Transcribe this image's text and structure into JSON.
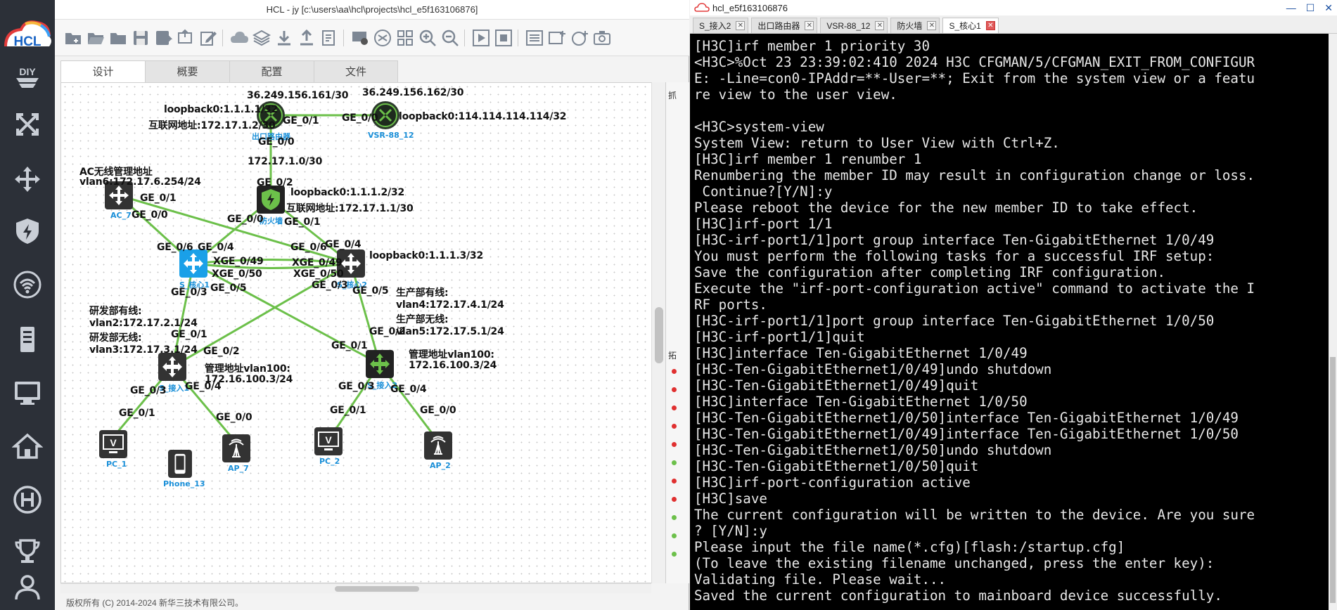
{
  "sidebar": {
    "logo_text": "HCL",
    "items": [
      {
        "name": "diy",
        "icon": "diy-icon"
      },
      {
        "name": "topology-tools",
        "icon": "arrows-cross-icon"
      },
      {
        "name": "move",
        "icon": "move-icon"
      },
      {
        "name": "security",
        "icon": "shield-icon"
      },
      {
        "name": "wireless",
        "icon": "wifi-icon"
      },
      {
        "name": "server",
        "icon": "server-icon"
      },
      {
        "name": "terminal",
        "icon": "monitor-icon"
      },
      {
        "name": "home",
        "icon": "home-icon"
      },
      {
        "name": "h3c",
        "icon": "h3c-logo-icon"
      },
      {
        "name": "achievement",
        "icon": "trophy-icon"
      },
      {
        "name": "user",
        "icon": "user-icon"
      }
    ]
  },
  "hcl": {
    "title": "HCL - jy [c:\\users\\aa\\hcl\\projects\\hcl_e5f163106876]",
    "tabs": [
      "设计",
      "概要",
      "配置",
      "文件"
    ],
    "active_tab": "设计",
    "footer": "版权所有 (C) 2014-2024 新华三技术有限公司。",
    "right_panel": {
      "header1": "抓",
      "header2": "拓"
    },
    "topology": {
      "devices": {
        "exit_router": "出口路由器",
        "vsr": "VSR-88_12",
        "firewall": "防火墙",
        "ac": "AC_7",
        "core1": "S_核心1",
        "core2": "S_核心2",
        "access1": "S_接入1",
        "access2": "S_接入2",
        "pc1": "PC_1",
        "pc2": "PC_2",
        "ap7": "AP_7",
        "ap2": "AP_2",
        "phone": "Phone_13"
      },
      "labels": {
        "l1": "36.249.156.161/30",
        "l2": "36.249.156.162/30",
        "l3": "loopback0:1.1.1.1/32",
        "l4": "互联网地址:172.17.1.2/30",
        "l5": "GE_0/1",
        "l6": "GE_0/0",
        "l7": "loopback0:114.114.114.114/32",
        "l8": "GE_0/0",
        "l9": "172.17.1.0/30",
        "l10": "AC无线管理地址",
        "l11": "vlan6:172.17.6.254/24",
        "l12": "GE_0/2",
        "l13": "loopback0:1.1.1.2/32",
        "l14": "互联网地址:172.17.1.1/30",
        "l15": "GE_0/1",
        "l16": "GE_0/0",
        "l17": "GE_0/0",
        "l18": "GE_0/1",
        "l19": "GE_0/6",
        "l20": "GE_0/4",
        "l21": "GE_0/6",
        "l22": "GE_0/4",
        "l23": "loopback0:1.1.1.3/32",
        "l24": "XGE_0/49",
        "l25": "XGE_0/49",
        "l26": "XGE_0/50",
        "l27": "XGE_0/50",
        "l28": "GE_0/3",
        "l29": "GE_0/5",
        "l30": "GE_0/3",
        "l31": "GE_0/5",
        "l32": "研发部有线:",
        "l33": "vlan2:172.17.2.1/24",
        "l34": "研发部无线:",
        "l35": "vlan3:172.17.3.1/24",
        "l36": "生产部有线:",
        "l37": "vlan4:172.17.4.1/24",
        "l38": "生产部无线:",
        "l39": "vlan5:172.17.5.1/24",
        "l40": "GE_0/1",
        "l41": "GE_0/2",
        "l42": "GE_0/2",
        "l43": "GE_0/1",
        "l44": "管理地址vlan100:",
        "l45": "172.16.100.3/24",
        "l46": "管理地址vlan100:",
        "l47": "172.16.100.3/24",
        "l48": "GE_0/3",
        "l49": "GE_0/4",
        "l50": "GE_0/3",
        "l51": "GE_0/4",
        "l52": "GE_0/1",
        "l53": "GE_0/0",
        "l54": "GE_0/1",
        "l55": "GE_0/0"
      },
      "link_color": "#6cc04a"
    }
  },
  "terminal": {
    "title": "hcl_e5f163106876",
    "tabs": [
      "S_接入2",
      "出口路由器",
      "VSR-88_12",
      "防火墙",
      "S_核心1"
    ],
    "active_tab": "S_核心1",
    "lines": [
      "[H3C]irf member 1 priority 30",
      "<H3C>%Oct 23 23:39:02:410 2024 H3C CFGMAN/5/CFGMAN_EXIT_FROM_CONFIGUR",
      "E: -Line=con0-IPAddr=**-User=**; Exit from the system view or a featu",
      "re view to the user view.",
      "",
      "<H3C>system-view",
      "System View: return to User View with Ctrl+Z.",
      "[H3C]irf member 1 renumber 1",
      "Renumbering the member ID may result in configuration change or loss.",
      " Continue?[Y/N]:y",
      "Please reboot the device for the new member ID to take effect.",
      "[H3C]irf-port 1/1",
      "[H3C-irf-port1/1]port group interface Ten-GigabitEthernet 1/0/49",
      "You must perform the following tasks for a successful IRF setup:",
      "Save the configuration after completing IRF configuration.",
      "Execute the \"irf-port-configuration active\" command to activate the I",
      "RF ports.",
      "[H3C-irf-port1/1]port group interface Ten-GigabitEthernet 1/0/50",
      "[H3C-irf-port1/1]quit",
      "[H3C]interface Ten-GigabitEthernet 1/0/49",
      "[H3C-Ten-GigabitEthernet1/0/49]undo shutdown",
      "[H3C-Ten-GigabitEthernet1/0/49]quit",
      "[H3C]interface Ten-GigabitEthernet 1/0/50",
      "[H3C-Ten-GigabitEthernet1/0/50]interface Ten-GigabitEthernet 1/0/49",
      "[H3C-Ten-GigabitEthernet1/0/49]interface Ten-GigabitEthernet 1/0/50",
      "[H3C-Ten-GigabitEthernet1/0/50]undo shutdown",
      "[H3C-Ten-GigabitEthernet1/0/50]quit",
      "[H3C]irf-port-configuration active",
      "[H3C]save",
      "The current configuration will be written to the device. Are you sure",
      "? [Y/N]:y",
      "Please input the file name(*.cfg)[flash:/startup.cfg]",
      "(To leave the existing filename unchanged, press the enter key):",
      "Validating file. Please wait...",
      "Saved the current configuration to mainboard device successfully."
    ]
  }
}
